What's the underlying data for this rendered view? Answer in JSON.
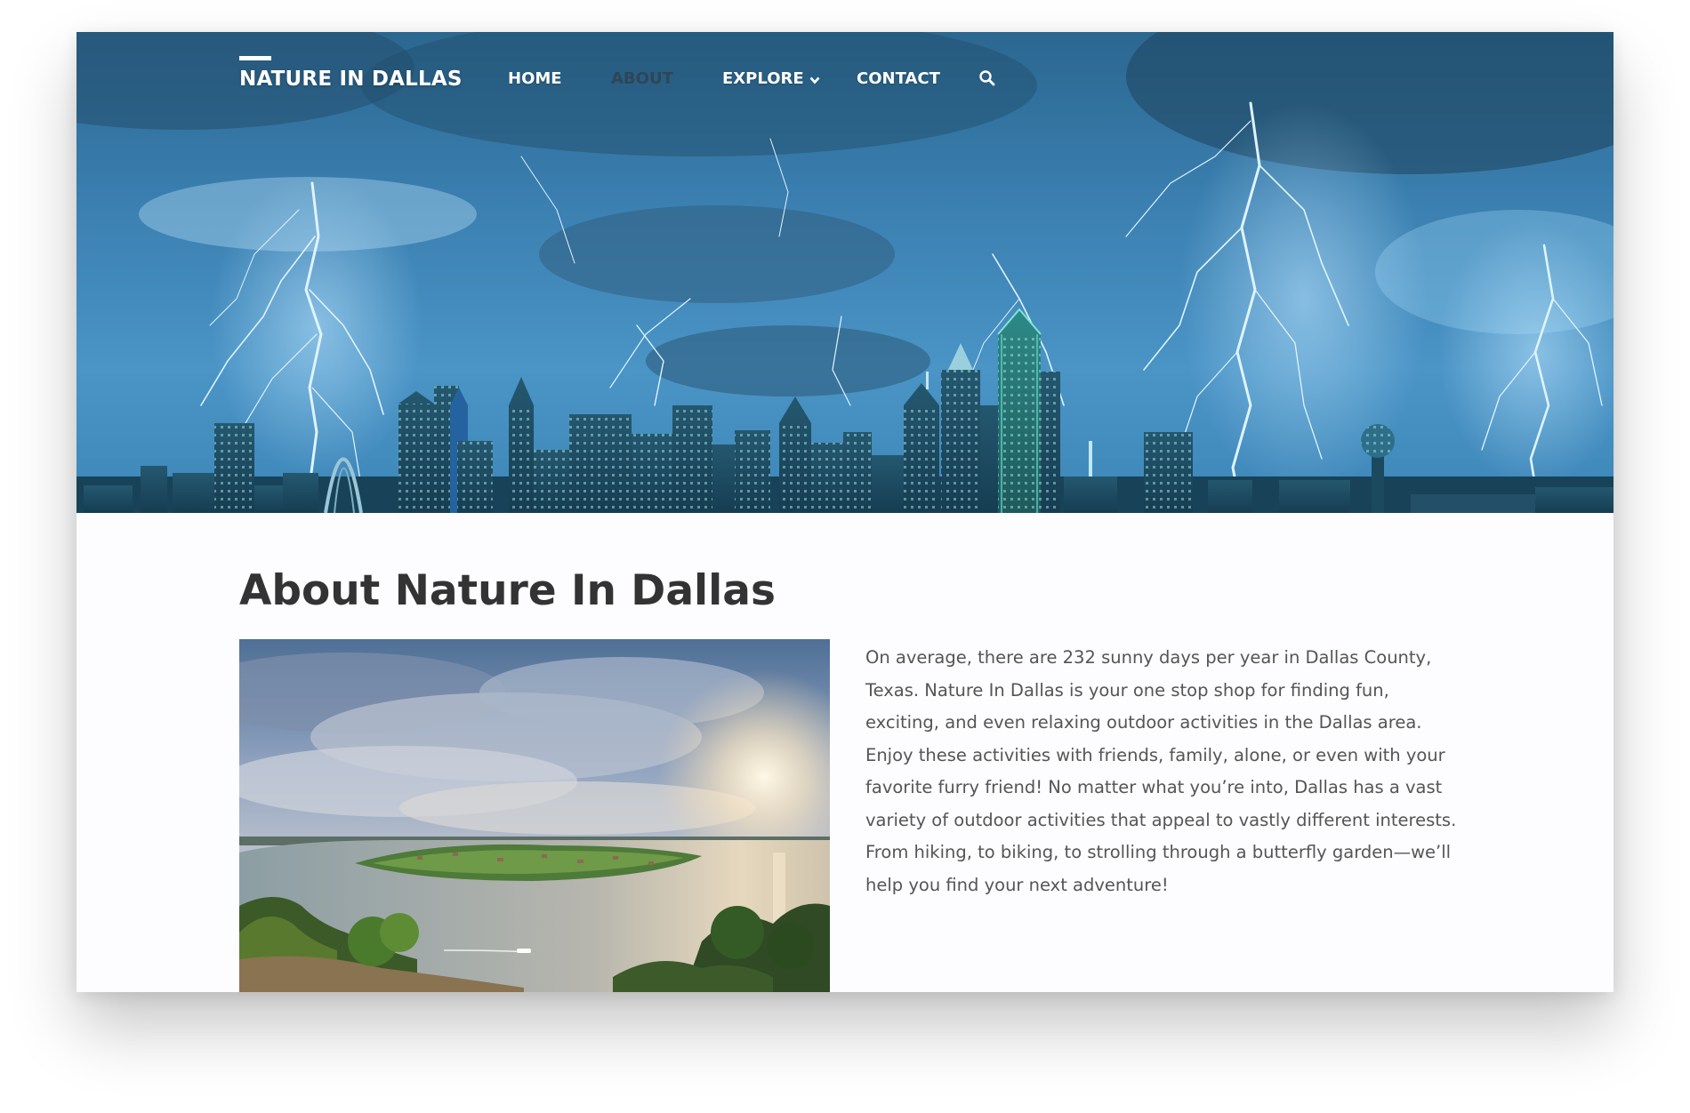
{
  "site": {
    "brand": "NATURE IN DALLAS"
  },
  "nav": {
    "items": [
      {
        "label": "HOME",
        "active": false
      },
      {
        "label": "ABOUT",
        "active": true
      },
      {
        "label": "EXPLORE",
        "active": false,
        "has_dropdown": true
      },
      {
        "label": "CONTACT",
        "active": false
      }
    ],
    "search_icon": "search-icon",
    "dropdown_icon": "chevron-down-icon"
  },
  "main": {
    "title": "About Nature In Dallas",
    "paragraph": "On average, there are 232 sunny days per year in Dallas County, Texas. Nature In Dallas is your one stop shop for finding fun, exciting, and even relaxing outdoor activities in the Dallas area. Enjoy these activities with friends, family, alone, or even with your favorite furry friend! No matter what you’re into, Dallas has a vast variety of outdoor activities that appeal to vastly different interests. From hiking, to biking, to strolling through a butterfly garden—we’ll help you find your next adventure!"
  },
  "colors": {
    "sky_top": "#2f6e97",
    "sky_mid": "#3f87b8",
    "nav_active": "#2f4556",
    "heading": "#333333",
    "text": "#555555",
    "page_bg": "#fdfcfe"
  }
}
